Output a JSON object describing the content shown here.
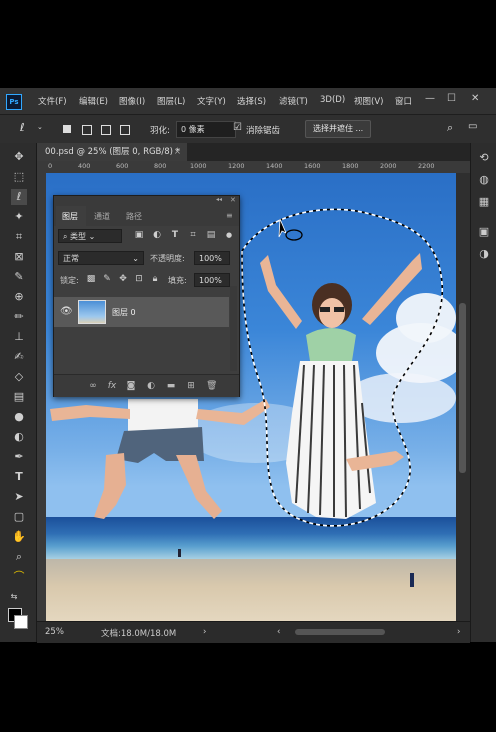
{
  "app_logo": "Ps",
  "menu": [
    "文件(F)",
    "编辑(E)",
    "图像(I)",
    "图层(L)",
    "文字(Y)",
    "选择(S)",
    "滤镜(T)",
    "3D(D)",
    "视图(V)",
    "窗口"
  ],
  "window_controls": {
    "minimize": "—",
    "restore": "☐",
    "close": "✕"
  },
  "options": {
    "feather_label": "羽化:",
    "feather_value": "0 像素",
    "antialias_label": "消除锯齿",
    "antialias_checked": true,
    "select_mask_button": "选择并遮住 ..."
  },
  "document": {
    "tab_title": "00.psd @ 25% (图层 0, RGB/8) *",
    "close": "×"
  },
  "ruler_ticks": [
    "0",
    "400",
    "600",
    "800",
    "1000",
    "1200",
    "1400",
    "1600",
    "1800",
    "2000",
    "2200"
  ],
  "status": {
    "zoom": "25%",
    "doc_info": "文档:18.0M/18.0M",
    "arrow": "›"
  },
  "layers_panel": {
    "collapse": "◂◂",
    "close": "✕",
    "tabs": [
      "图层",
      "通道",
      "路径"
    ],
    "active_tab": 0,
    "menu_icon": "≡",
    "filter_kind": "类型",
    "blend_mode": "正常",
    "opacity_label": "不透明度:",
    "opacity_value": "100%",
    "lock_label": "锁定:",
    "fill_label": "填充:",
    "fill_value": "100%",
    "layers": [
      {
        "name": "图层 0",
        "visible": true
      }
    ]
  },
  "colors": {
    "accent": "#31a8ff",
    "panel_bg": "#3e3e3e",
    "app_bg": "#2b2b2b"
  },
  "icons": {
    "toolbar": [
      "move-icon",
      "marquee-icon",
      "lasso-icon",
      "magic-wand-icon",
      "crop-icon",
      "frame-icon",
      "eyedropper-icon",
      "healing-icon",
      "brush-icon",
      "stamp-icon",
      "history-brush-icon",
      "eraser-icon",
      "gradient-icon",
      "blur-icon",
      "dodge-icon",
      "pen-icon",
      "type-icon",
      "path-select-icon",
      "shape-icon",
      "hand-icon",
      "zoom-icon",
      "edit-toolbar-icon"
    ]
  }
}
